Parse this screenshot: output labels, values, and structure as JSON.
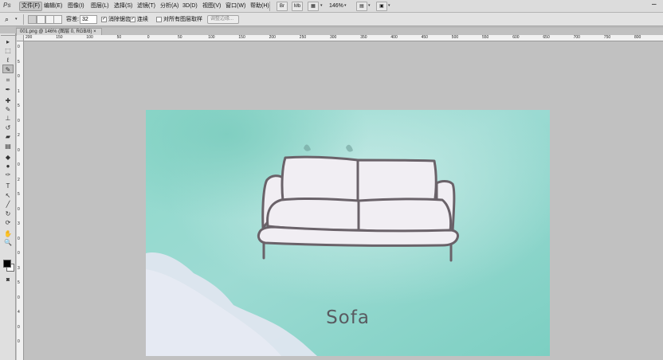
{
  "app": {
    "logo": "Ps"
  },
  "menu": {
    "items": [
      "文件(F)",
      "编辑(E)",
      "图像(I)",
      "图层(L)",
      "选择(S)",
      "滤镜(T)",
      "分析(A)",
      "3D(D)",
      "视图(V)",
      "窗口(W)",
      "帮助(H)"
    ],
    "active_index": 0
  },
  "menubar_right": {
    "zoom": "146%",
    "caret": "▾",
    "window_minimize": "–"
  },
  "options": {
    "tolerance_label": "容差:",
    "tolerance_value": "32",
    "antialias_label": "消除锯齿",
    "antialias_checked": "✓",
    "contiguous_label": "连续",
    "contiguous_checked": "✓",
    "sample_all_label": "对所有图层取样",
    "refine_edge_label": "调整边缘..."
  },
  "document": {
    "tab_title": "001.png @ 146% (图层 0, RGB/8) ×",
    "close_glyph": "×"
  },
  "ruler": {
    "top_labels": [
      "200",
      "150",
      "100",
      "50",
      "0",
      "50",
      "100",
      "150",
      "200",
      "250",
      "300",
      "350",
      "400",
      "450",
      "500",
      "550",
      "600",
      "650",
      "700",
      "750",
      "800"
    ],
    "left_labels": [
      "0",
      "5",
      "0",
      "1",
      "5",
      "0",
      "2",
      "0",
      "0",
      "2",
      "5",
      "0",
      "3",
      "0",
      "0",
      "3",
      "5",
      "0",
      "4",
      "0",
      "0"
    ]
  },
  "image_content": {
    "caption": "Sofa"
  },
  "tools": [
    {
      "name": "move-tool",
      "glyph": "▸"
    },
    {
      "name": "marquee-tool",
      "glyph": "⬚"
    },
    {
      "name": "lasso-tool",
      "glyph": "ℓ"
    },
    {
      "name": "quick-selection-tool",
      "glyph": "✎"
    },
    {
      "name": "crop-tool",
      "glyph": "⌗"
    },
    {
      "name": "eyedropper-tool",
      "glyph": "✒"
    },
    {
      "name": "spot-healing-tool",
      "glyph": "✚"
    },
    {
      "name": "brush-tool",
      "glyph": "✎"
    },
    {
      "name": "clone-stamp-tool",
      "glyph": "⊥"
    },
    {
      "name": "history-brush-tool",
      "glyph": "↺"
    },
    {
      "name": "eraser-tool",
      "glyph": "▰"
    },
    {
      "name": "gradient-tool",
      "glyph": "▤"
    },
    {
      "name": "blur-tool",
      "glyph": "◆"
    },
    {
      "name": "dodge-tool",
      "glyph": "●"
    },
    {
      "name": "pen-tool",
      "glyph": "✑"
    },
    {
      "name": "type-tool",
      "glyph": "T"
    },
    {
      "name": "path-selection-tool",
      "glyph": "↖"
    },
    {
      "name": "shape-tool",
      "glyph": "╱"
    },
    {
      "name": "3d-rotate-tool",
      "glyph": "↻"
    },
    {
      "name": "3d-orbit-tool",
      "glyph": "⟳"
    },
    {
      "name": "hand-tool",
      "glyph": "✋"
    },
    {
      "name": "zoom-tool",
      "glyph": "🔍"
    }
  ],
  "colors": {
    "chrome": "#dcdcdc",
    "canvas_bg": "#c1c1c1",
    "watercolor_teal": "#7ed3c6",
    "sofa_outline": "#6a6269",
    "sofa_fill": "#f1eef3",
    "caption": "#595a60"
  }
}
